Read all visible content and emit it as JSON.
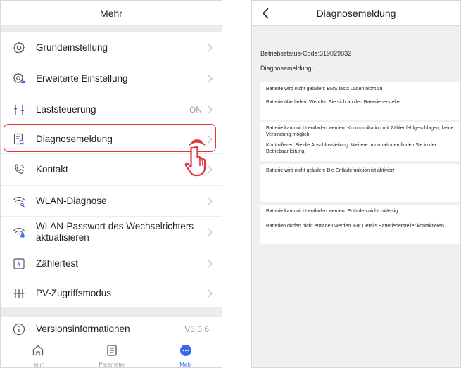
{
  "left": {
    "title": "Mehr",
    "items": [
      {
        "label": "Grundeinstellung",
        "icon": "settings-gear-icon",
        "value": ""
      },
      {
        "label": "Erweiterte Einstellung",
        "icon": "advanced-settings-icon",
        "value": ""
      },
      {
        "label": "Laststeuerung",
        "icon": "load-control-icon",
        "value": "ON"
      },
      {
        "label": "Diagnosemeldung",
        "icon": "diagnosis-report-icon",
        "value": ""
      },
      {
        "label": "Kontakt",
        "icon": "phone-contact-icon",
        "value": ""
      },
      {
        "label": "WLAN-Diagnose",
        "icon": "wifi-diagnose-icon",
        "value": ""
      },
      {
        "label": "WLAN-Passwort des Wechselrichters aktualisieren",
        "icon": "wifi-password-icon",
        "value": ""
      },
      {
        "label": "Zählertest",
        "icon": "meter-test-icon",
        "value": ""
      },
      {
        "label": "PV-Zugriffsmodus",
        "icon": "pv-access-icon",
        "value": ""
      },
      {
        "label": "Versionsinformationen",
        "icon": "info-icon",
        "value": "V5.0.6"
      }
    ],
    "tabs": [
      {
        "label": "Heim",
        "icon": "home-icon"
      },
      {
        "label": "Parameter",
        "icon": "parameter-icon"
      },
      {
        "label": "Mehr",
        "icon": "more-icon"
      }
    ],
    "accent": "#3a66e8",
    "highlight_color": "#e2333a"
  },
  "right": {
    "title": "Diagnosemeldung",
    "status_code": "Betriebsstatus-Code:319029832",
    "diag_label": "Diagnosemeldung:",
    "cards": [
      {
        "lines": [
          "Batterie wird nicht geladen: BMS lässt Laden nicht zu",
          "Batterie überladen. Wenden Sie sich an den Batteriehersteller"
        ]
      },
      {
        "lines": [
          "Batterie kann nicht entladen werden: Kommunikation mit Zähler fehlgeschlagen, keine Verbindung möglich",
          "Kontrollieren Sie die Anschlussleitung. Weitere Informationen finden Sie in der Betriebsanleitung."
        ]
      },
      {
        "lines": [
          "Batterie wird nicht geladen: Die Entladefunktion ist aktiviert"
        ]
      },
      {
        "lines": [
          "Batterie kann nicht entladen werden: Entladen nicht zulässig",
          "Batterien dürfen nicht entladen werden. Für Details Batteriehersteller kontaktieren."
        ]
      }
    ]
  }
}
